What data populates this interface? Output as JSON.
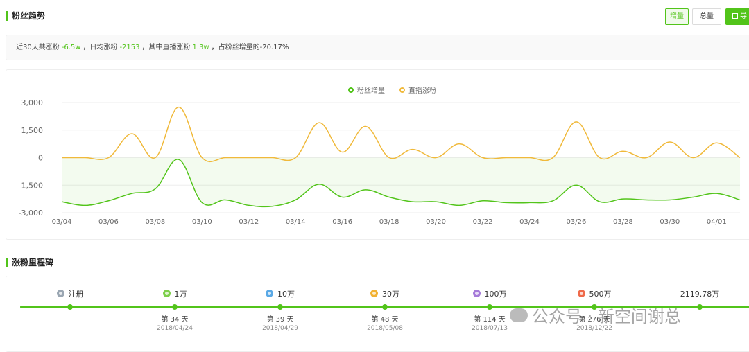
{
  "header": {
    "fans_trend_title": "粉丝趋势",
    "toggle_increment": "增量",
    "toggle_total": "总量",
    "export_label": "导"
  },
  "summary": {
    "p1": "近30天共涨粉",
    "v1": "-6.5w",
    "p2": "，日均涨粉",
    "v2": "-2153",
    "p3": "，其中直播涨粉",
    "v3": "1.3w",
    "p4": "，占粉丝增量的-20.17%"
  },
  "colors": {
    "green": "#52c41a",
    "yellow": "#f0b93a",
    "grid": "#eeeeee"
  },
  "chart_data": {
    "type": "line",
    "x": [
      "03/04",
      "03/05",
      "03/06",
      "03/07",
      "03/08",
      "03/09",
      "03/10",
      "03/11",
      "03/12",
      "03/13",
      "03/14",
      "03/15",
      "03/16",
      "03/17",
      "03/18",
      "03/19",
      "03/20",
      "03/21",
      "03/22",
      "03/23",
      "03/24",
      "03/25",
      "03/26",
      "03/27",
      "03/28",
      "03/29",
      "03/30",
      "03/31",
      "04/01",
      "04/02"
    ],
    "xticks": [
      "03/04",
      "03/06",
      "03/08",
      "03/10",
      "03/12",
      "03/14",
      "03/16",
      "03/18",
      "03/20",
      "03/22",
      "03/24",
      "03/26",
      "03/28",
      "03/30",
      "04/01"
    ],
    "yticks": [
      "3,000",
      "1,500",
      "0",
      "-1,500",
      "-3,000"
    ],
    "ylim": [
      -3000,
      3000
    ],
    "grid": true,
    "legend": "top-center",
    "series": [
      {
        "name": "粉丝增量",
        "color": "#52c41a",
        "area": true,
        "values": [
          -2400,
          -2600,
          -2350,
          -1950,
          -1700,
          -100,
          -2450,
          -2300,
          -2600,
          -2650,
          -2300,
          -1450,
          -2150,
          -1750,
          -2150,
          -2400,
          -2400,
          -2600,
          -2350,
          -2450,
          -2450,
          -2350,
          -1500,
          -2400,
          -2250,
          -2300,
          -2300,
          -2150,
          -1950,
          -2300
        ]
      },
      {
        "name": "直播涨粉",
        "color": "#f0b93a",
        "area": false,
        "values": [
          0,
          0,
          0,
          1300,
          0,
          2750,
          0,
          0,
          0,
          0,
          0,
          1900,
          300,
          1700,
          0,
          450,
          0,
          750,
          0,
          0,
          0,
          0,
          1950,
          0,
          350,
          0,
          850,
          0,
          800,
          0
        ]
      }
    ]
  },
  "milestone": {
    "title": "涨粉里程碑",
    "items": [
      {
        "label": "注册",
        "badge": "#9aa6b2",
        "day": "",
        "date": ""
      },
      {
        "label": "1万",
        "badge": "#7ccf4a",
        "day": "第 34 天",
        "date": "2018/04/24"
      },
      {
        "label": "10万",
        "badge": "#5aa9e6",
        "day": "第 39 天",
        "date": "2018/04/29"
      },
      {
        "label": "30万",
        "badge": "#f2b233",
        "day": "第 48 天",
        "date": "2018/05/08"
      },
      {
        "label": "100万",
        "badge": "#a57ad9",
        "day": "第 114 天",
        "date": "2018/07/13"
      },
      {
        "label": "500万",
        "badge": "#ef6a4a",
        "day": "第 276 天",
        "date": "2018/12/22"
      },
      {
        "label": "2119.78万",
        "badge": "",
        "day": "",
        "date": ""
      }
    ]
  },
  "watermark": "公众号 · 新空间谢总"
}
